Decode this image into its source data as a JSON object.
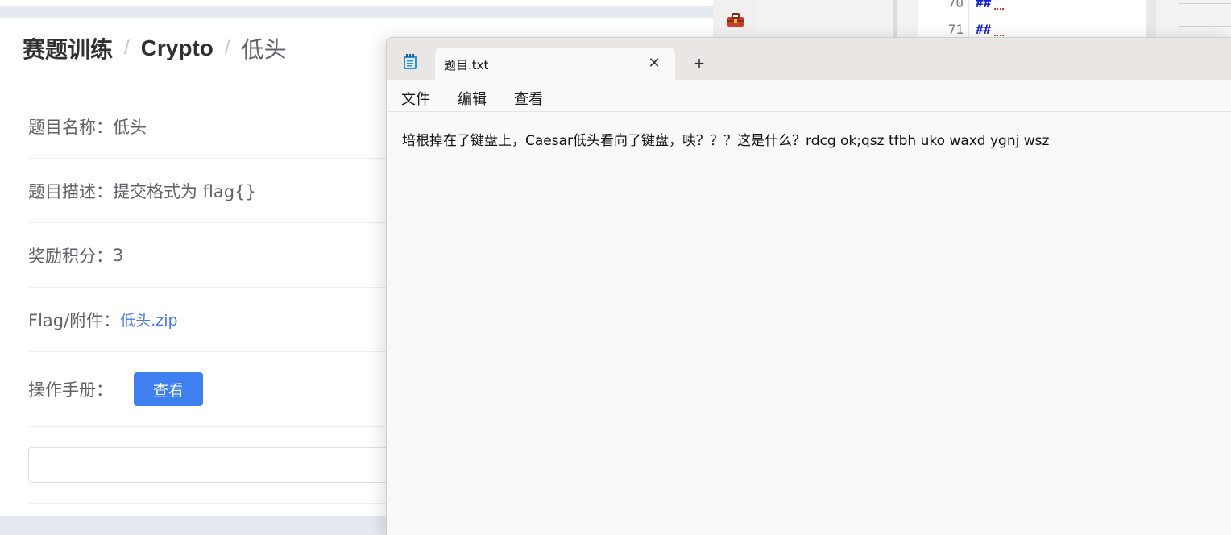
{
  "web": {
    "breadcrumb": {
      "root": "赛题训练",
      "sep1": "/",
      "category": "Crypto",
      "sep2": "/",
      "current": "低头"
    },
    "fields": {
      "name_label": "题目名称：",
      "name_value": "低头",
      "desc_label": "题目描述：",
      "desc_value": "提交格式为 flag{}",
      "points_label": "奖励积分：",
      "points_value": "3",
      "attachment_label": "Flag/附件：",
      "attachment_link": "低头.zip",
      "manual_label": "操作手册：",
      "manual_button": "查看"
    },
    "flag_input": {
      "placeholder": ""
    },
    "colors": {
      "accent": "#3f7ff0",
      "link": "#4a7de2"
    }
  },
  "editor_bg": {
    "toolbox_icon": "toolbox-icon",
    "lines": [
      {
        "number": "70",
        "code": "##"
      },
      {
        "number": "71",
        "code": "##"
      }
    ]
  },
  "notepad": {
    "tab_title": "题目.txt",
    "close_glyph": "✕",
    "newtab_glyph": "+",
    "menu": {
      "file": "文件",
      "edit": "编辑",
      "view": "查看"
    },
    "content": "培根掉在了键盘上，Caesar低头看向了键盘，咦？？？这是什么？rdcg ok;qsz tfbh uko waxd ygnj wsz",
    "app_icon": "notepad-icon"
  }
}
